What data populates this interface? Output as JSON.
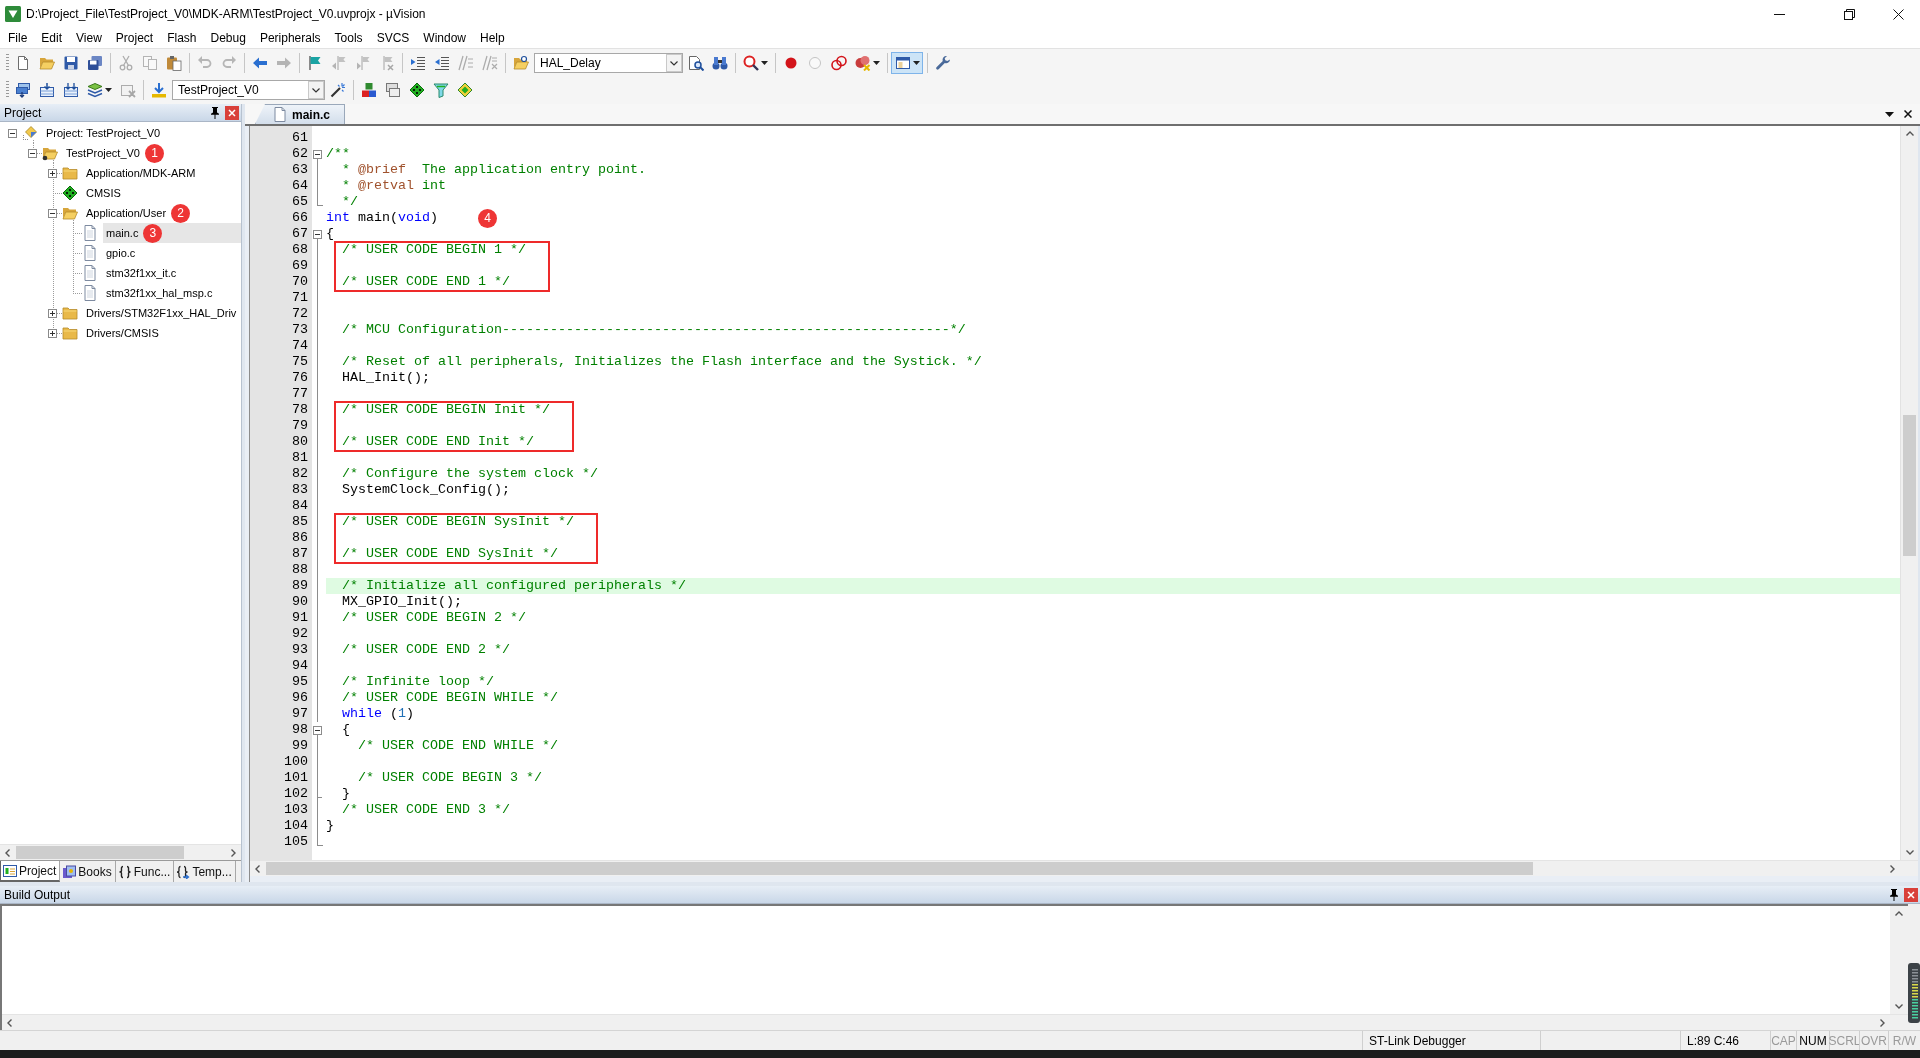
{
  "window": {
    "title": "D:\\Project_File\\TestProject_V0\\MDK-ARM\\TestProject_V0.uvprojx - µVision"
  },
  "menu": [
    "File",
    "Edit",
    "View",
    "Project",
    "Flash",
    "Debug",
    "Peripherals",
    "Tools",
    "SVCS",
    "Window",
    "Help"
  ],
  "toolbars": [
    {
      "items": [
        {
          "kind": "new",
          "disabled": false,
          "pressed": false
        },
        {
          "kind": "open",
          "disabled": false,
          "pressed": false
        },
        {
          "kind": "save",
          "disabled": false,
          "pressed": false
        },
        {
          "kind": "save_all",
          "disabled": false,
          "pressed": false
        },
        {
          "kind": "separator"
        },
        {
          "kind": "cut",
          "disabled": true,
          "pressed": false
        },
        {
          "kind": "copy",
          "disabled": true,
          "pressed": false
        },
        {
          "kind": "paste",
          "disabled": false,
          "pressed": false
        },
        {
          "kind": "separator"
        },
        {
          "kind": "undo",
          "disabled": true,
          "pressed": false
        },
        {
          "kind": "redo",
          "disabled": true,
          "pressed": false
        },
        {
          "kind": "separator"
        },
        {
          "kind": "back",
          "disabled": false,
          "pressed": false
        },
        {
          "kind": "forward",
          "disabled": true,
          "pressed": false
        },
        {
          "kind": "separator"
        },
        {
          "kind": "bookmark",
          "disabled": false,
          "pressed": false
        },
        {
          "kind": "bookmark_prev",
          "disabled": true,
          "pressed": false
        },
        {
          "kind": "bookmark_next",
          "disabled": true,
          "pressed": false
        },
        {
          "kind": "bookmark_clear",
          "disabled": true,
          "pressed": false
        },
        {
          "kind": "separator"
        },
        {
          "kind": "indent",
          "disabled": false,
          "pressed": false
        },
        {
          "kind": "unindent",
          "disabled": false,
          "pressed": false
        },
        {
          "kind": "comment",
          "disabled": true,
          "pressed": false
        },
        {
          "kind": "uncomment",
          "disabled": true,
          "pressed": false
        },
        {
          "kind": "separator"
        },
        {
          "kind": "find_in_files",
          "disabled": false,
          "pressed": false
        },
        {
          "kind": "combo",
          "value": "HAL_Delay"
        },
        {
          "kind": "find",
          "disabled": false,
          "pressed": false
        },
        {
          "kind": "incremental_find",
          "disabled": false,
          "pressed": false
        },
        {
          "kind": "separator"
        },
        {
          "kind": "debug",
          "disabled": false,
          "pressed": false,
          "dropdown": true
        },
        {
          "kind": "separator"
        },
        {
          "kind": "breakpoint",
          "disabled": false,
          "pressed": false
        },
        {
          "kind": "enable_breakpoint",
          "disabled": true,
          "pressed": false
        },
        {
          "kind": "disable_breakpoints",
          "disabled": false,
          "pressed": false
        },
        {
          "kind": "kill_breakpoints",
          "disabled": false,
          "pressed": false,
          "dropdown": true
        },
        {
          "kind": "separator"
        },
        {
          "kind": "window",
          "disabled": false,
          "pressed": true,
          "dropdown": true
        },
        {
          "kind": "separator"
        },
        {
          "kind": "configure",
          "disabled": false,
          "pressed": false
        }
      ]
    },
    {
      "items": [
        {
          "kind": "translate",
          "disabled": false,
          "pressed": false
        },
        {
          "kind": "build",
          "disabled": false,
          "pressed": false
        },
        {
          "kind": "rebuild",
          "disabled": false,
          "pressed": false
        },
        {
          "kind": "batch_build",
          "disabled": false,
          "pressed": false,
          "dropdown": true
        },
        {
          "kind": "stop_build",
          "disabled": true,
          "pressed": false
        },
        {
          "kind": "separator"
        },
        {
          "kind": "download",
          "disabled": false,
          "pressed": false
        },
        {
          "kind": "combo",
          "value": "TestProject_V0"
        },
        {
          "kind": "options",
          "disabled": false,
          "pressed": false
        },
        {
          "kind": "separator"
        },
        {
          "kind": "manage_items",
          "disabled": false,
          "pressed": false
        },
        {
          "kind": "select_packs",
          "disabled": false,
          "pressed": false
        },
        {
          "kind": "manage_rte",
          "disabled": false,
          "pressed": false
        },
        {
          "kind": "pack_filter",
          "disabled": false,
          "pressed": false
        },
        {
          "kind": "pack_installer",
          "disabled": false,
          "pressed": false
        }
      ]
    }
  ],
  "project_panel": {
    "title": "Project",
    "tree": [
      {
        "kind": "project",
        "label": "Project: TestProject_V0",
        "expanded": true,
        "selected": false,
        "children": [
          {
            "kind": "target",
            "label": "TestProject_V0",
            "expanded": true,
            "selected": false,
            "badge": "1",
            "children": [
              {
                "kind": "group",
                "label": "Application/MDK-ARM",
                "expanded": false,
                "selected": false
              },
              {
                "kind": "component",
                "label": "CMSIS",
                "selected": false
              },
              {
                "kind": "group",
                "label": "Application/User",
                "expanded": true,
                "selected": false,
                "badge": "2",
                "children": [
                  {
                    "kind": "file",
                    "label": "main.c",
                    "selected": true,
                    "badge": "3"
                  },
                  {
                    "kind": "file",
                    "label": "gpio.c",
                    "selected": false
                  },
                  {
                    "kind": "file",
                    "label": "stm32f1xx_it.c",
                    "selected": false
                  },
                  {
                    "kind": "file",
                    "label": "stm32f1xx_hal_msp.c",
                    "selected": false
                  }
                ]
              },
              {
                "kind": "group",
                "label": "Drivers/STM32F1xx_HAL_Driv",
                "expanded": false,
                "selected": false
              },
              {
                "kind": "group",
                "label": "Drivers/CMSIS",
                "expanded": false,
                "selected": false
              }
            ]
          }
        ]
      }
    ],
    "tabs": [
      {
        "kind": "project",
        "label": "Project",
        "selected": true
      },
      {
        "kind": "books",
        "label": "Books",
        "selected": false
      },
      {
        "kind": "functions",
        "label": "Func...",
        "selected": false
      },
      {
        "kind": "templates",
        "label": "Temp...",
        "selected": false
      }
    ]
  },
  "editor": {
    "tabs": [
      {
        "label": "main.c",
        "selected": true
      }
    ],
    "lines": [
      {
        "kind": "line",
        "number": "61",
        "current": false
      },
      {
        "kind": "fold",
        "expanded": true,
        "lines": [
          {
            "kind": "line",
            "number": "62",
            "current": false,
            "tokens": [
              {
                "kind": "comment",
                "text": "/**"
              }
            ]
          },
          {
            "kind": "line",
            "number": "63",
            "current": false,
            "tokens": [
              {
                "kind": "comment",
                "text": "  * "
              },
              {
                "kind": "doc_tag",
                "text": "@brief"
              },
              {
                "kind": "comment",
                "text": "  The application entry point."
              }
            ]
          },
          {
            "kind": "line",
            "number": "64",
            "current": false,
            "tokens": [
              {
                "kind": "comment",
                "text": "  * "
              },
              {
                "kind": "doc_tag",
                "text": "@retval"
              },
              {
                "kind": "comment",
                "text": " int"
              }
            ]
          },
          {
            "kind": "line",
            "number": "65",
            "current": false,
            "tokens": [
              {
                "kind": "comment",
                "text": "  */"
              }
            ]
          }
        ]
      },
      {
        "kind": "line",
        "number": "66",
        "current": false,
        "badge": "4",
        "tokens": [
          {
            "kind": "keyword",
            "text": "int"
          },
          {
            "kind": "plain",
            "text": " main("
          },
          {
            "kind": "keyword",
            "text": "void"
          },
          {
            "kind": "plain",
            "text": ")"
          }
        ]
      },
      {
        "kind": "fold",
        "expanded": true,
        "lines": [
          {
            "kind": "line",
            "number": "67",
            "current": false,
            "tokens": [
              {
                "kind": "plain",
                "text": "{"
              }
            ]
          },
          {
            "kind": "marked",
            "lines": [
              {
                "kind": "line",
                "number": "68",
                "current": false,
                "tokens": [
                  {
                    "kind": "comment",
                    "text": "  /* USER CODE BEGIN 1 */"
                  }
                ]
              },
              {
                "kind": "line",
                "number": "69",
                "current": false
              },
              {
                "kind": "line",
                "number": "70",
                "current": false,
                "tokens": [
                  {
                    "kind": "comment",
                    "text": "  /* USER CODE END 1 */"
                  }
                ]
              }
            ]
          },
          {
            "kind": "line",
            "number": "71",
            "current": false
          },
          {
            "kind": "line",
            "number": "72",
            "current": false
          },
          {
            "kind": "line",
            "number": "73",
            "current": false,
            "tokens": [
              {
                "kind": "comment",
                "text": "  /* MCU Configuration--------------------------------------------------------*/"
              }
            ]
          },
          {
            "kind": "line",
            "number": "74",
            "current": false
          },
          {
            "kind": "line",
            "number": "75",
            "current": false,
            "tokens": [
              {
                "kind": "comment",
                "text": "  /* Reset of all peripherals, Initializes the Flash interface and the Systick. */"
              }
            ]
          },
          {
            "kind": "line",
            "number": "76",
            "current": false,
            "tokens": [
              {
                "kind": "plain",
                "text": "  HAL_Init();"
              }
            ]
          },
          {
            "kind": "line",
            "number": "77",
            "current": false
          },
          {
            "kind": "marked",
            "lines": [
              {
                "kind": "line",
                "number": "78",
                "current": false,
                "tokens": [
                  {
                    "kind": "comment",
                    "text": "  /* USER CODE BEGIN Init */"
                  }
                ]
              },
              {
                "kind": "line",
                "number": "79",
                "current": false
              },
              {
                "kind": "line",
                "number": "80",
                "current": false,
                "tokens": [
                  {
                    "kind": "comment",
                    "text": "  /* USER CODE END Init */"
                  }
                ]
              }
            ]
          },
          {
            "kind": "line",
            "number": "81",
            "current": false
          },
          {
            "kind": "line",
            "number": "82",
            "current": false,
            "tokens": [
              {
                "kind": "comment",
                "text": "  /* Configure the system clock */"
              }
            ]
          },
          {
            "kind": "line",
            "number": "83",
            "current": false,
            "tokens": [
              {
                "kind": "plain",
                "text": "  SystemClock_Config();"
              }
            ]
          },
          {
            "kind": "line",
            "number": "84",
            "current": false
          },
          {
            "kind": "marked",
            "lines": [
              {
                "kind": "line",
                "number": "85",
                "current": false,
                "tokens": [
                  {
                    "kind": "comment",
                    "text": "  /* USER CODE BEGIN SysInit */"
                  }
                ]
              },
              {
                "kind": "line",
                "number": "86",
                "current": false
              },
              {
                "kind": "line",
                "number": "87",
                "current": false,
                "tokens": [
                  {
                    "kind": "comment",
                    "text": "  /* USER CODE END SysInit */"
                  }
                ]
              }
            ]
          },
          {
            "kind": "line",
            "number": "88",
            "current": false
          },
          {
            "kind": "line",
            "number": "89",
            "current": true,
            "tokens": [
              {
                "kind": "comment",
                "text": "  /* Initialize all configured peripherals */"
              }
            ]
          },
          {
            "kind": "line",
            "number": "90",
            "current": false,
            "tokens": [
              {
                "kind": "plain",
                "text": "  MX_GPIO_Init();"
              }
            ]
          },
          {
            "kind": "line",
            "number": "91",
            "current": false,
            "tokens": [
              {
                "kind": "comment",
                "text": "  /* USER CODE BEGIN 2 */"
              }
            ]
          },
          {
            "kind": "line",
            "number": "92",
            "current": false
          },
          {
            "kind": "line",
            "number": "93",
            "current": false,
            "tokens": [
              {
                "kind": "comment",
                "text": "  /* USER CODE END 2 */"
              }
            ]
          },
          {
            "kind": "line",
            "number": "94",
            "current": false
          },
          {
            "kind": "line",
            "number": "95",
            "current": false,
            "tokens": [
              {
                "kind": "comment",
                "text": "  /* Infinite loop */"
              }
            ]
          },
          {
            "kind": "line",
            "number": "96",
            "current": false,
            "tokens": [
              {
                "kind": "comment",
                "text": "  /* USER CODE BEGIN WHILE */"
              }
            ]
          },
          {
            "kind": "line",
            "number": "97",
            "current": false,
            "tokens": [
              {
                "kind": "keyword",
                "text": "  while"
              },
              {
                "kind": "plain",
                "text": " ("
              },
              {
                "kind": "number",
                "text": "1"
              },
              {
                "kind": "plain",
                "text": ")"
              }
            ]
          },
          {
            "kind": "fold",
            "expanded": true,
            "lines": [
              {
                "kind": "line",
                "number": "98",
                "current": false,
                "tokens": [
                  {
                    "kind": "plain",
                    "text": "  {"
                  }
                ]
              },
              {
                "kind": "line",
                "number": "99",
                "current": false,
                "tokens": [
                  {
                    "kind": "comment",
                    "text": "    /* USER CODE END WHILE */"
                  }
                ]
              },
              {
                "kind": "line",
                "number": "100",
                "current": false
              },
              {
                "kind": "line",
                "number": "101",
                "current": false,
                "tokens": [
                  {
                    "kind": "comment",
                    "text": "    /* USER CODE BEGIN 3 */"
                  }
                ]
              },
              {
                "kind": "line",
                "number": "102",
                "current": false,
                "tokens": [
                  {
                    "kind": "plain",
                    "text": "  }"
                  }
                ]
              }
            ]
          },
          {
            "kind": "line",
            "number": "103",
            "current": false,
            "tokens": [
              {
                "kind": "comment",
                "text": "  /* USER CODE END 3 */"
              }
            ]
          },
          {
            "kind": "line",
            "number": "104",
            "current": false,
            "tokens": [
              {
                "kind": "plain",
                "text": "}"
              }
            ]
          },
          {
            "kind": "line",
            "number": "105",
            "current": false
          }
        ]
      }
    ]
  },
  "build_output": {
    "title": "Build Output"
  },
  "status_bar": {
    "debugger": "ST-Link Debugger",
    "cursor": "L:89 C:46",
    "indicators": [
      {
        "label": "CAP",
        "on": false
      },
      {
        "label": "NUM",
        "on": true
      },
      {
        "label": "SCRL",
        "on": false
      },
      {
        "label": "OVR",
        "on": false
      },
      {
        "label": "R/W",
        "on": false
      }
    ]
  }
}
